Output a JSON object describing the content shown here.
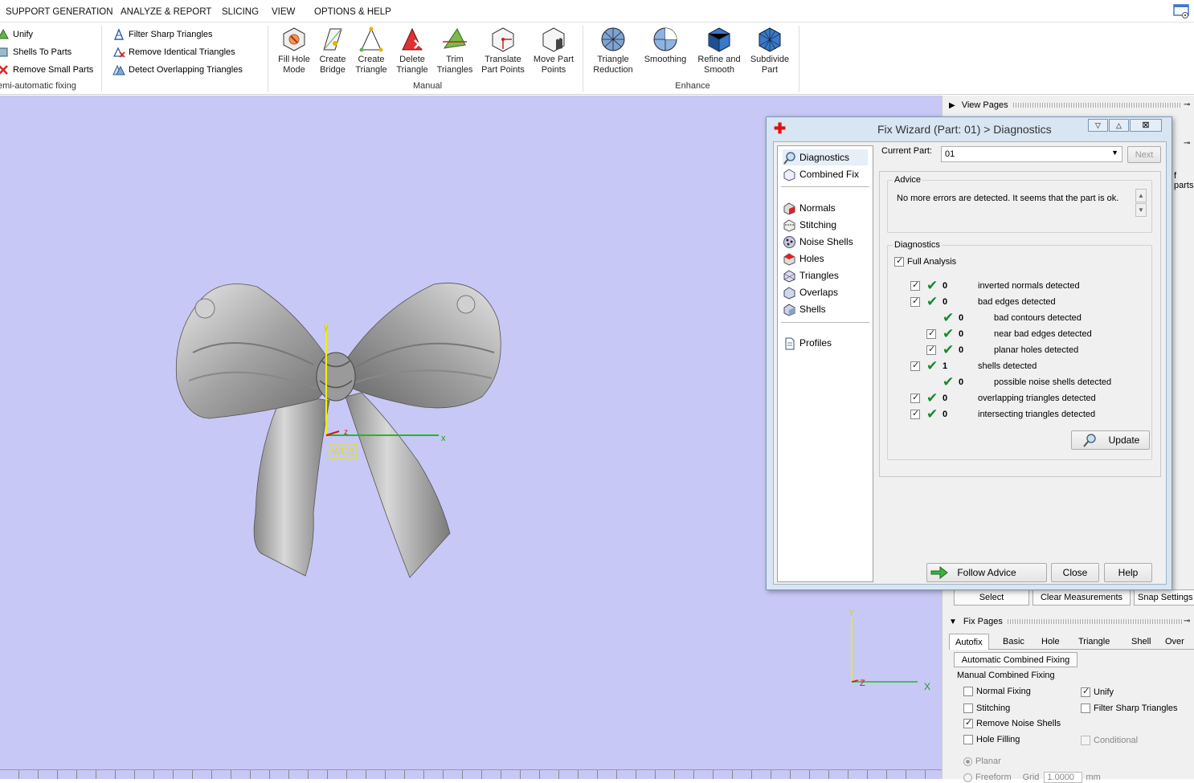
{
  "menubar": {
    "items": [
      "SUPPORT GENERATION",
      "ANALYZE & REPORT",
      "SLICING",
      "VIEW",
      "OPTIONS & HELP"
    ]
  },
  "ribbon": {
    "semi_auto_tools": [
      "Unify",
      "Shells To Parts",
      "Remove Small Parts"
    ],
    "semi_auto_title": "emi-automatic fixing",
    "filter_tools": [
      "Filter Sharp Triangles",
      "Remove Identical Triangles",
      "Detect Overlapping Triangles"
    ],
    "manual_tools": [
      {
        "line1": "Fill Hole",
        "line2": "Mode"
      },
      {
        "line1": "Create",
        "line2": "Bridge"
      },
      {
        "line1": "Create",
        "line2": "Triangle"
      },
      {
        "line1": "Delete",
        "line2": "Triangle"
      },
      {
        "line1": "Trim",
        "line2": "Triangles"
      },
      {
        "line1": "Translate",
        "line2": "Part Points"
      },
      {
        "line1": "Move Part",
        "line2": "Points"
      }
    ],
    "manual_title": "Manual",
    "enhance_tools": [
      {
        "line1": "Triangle",
        "line2": "Reduction"
      },
      {
        "line1": "Smoothing",
        "line2": ""
      },
      {
        "line1": "Refine and",
        "line2": "Smooth"
      },
      {
        "line1": "Subdivide",
        "line2": "Part"
      }
    ],
    "enhance_title": "Enhance"
  },
  "viewport": {
    "wcs_label": "WCS",
    "axis_x": "x",
    "axis_y": "y",
    "axis_z": "z",
    "mini_x": "X",
    "mini_y": "Y",
    "mini_z": "Z"
  },
  "right_panel": {
    "view_pages": "View Pages",
    "parts_fragment": "f parts",
    "measure_buttons": [
      "Select",
      "Clear Measurements",
      "Snap Settings"
    ],
    "fix_pages": "Fix Pages",
    "tabs": [
      "Autofix",
      "Basic",
      "Hole",
      "Triangle",
      "Shell",
      "Over"
    ],
    "auto_combined": "Automatic Combined Fixing",
    "manual_combined": "Manual Combined Fixing",
    "options_left": [
      {
        "label": "Normal Fixing",
        "checked": false
      },
      {
        "label": "Stitching",
        "checked": false
      },
      {
        "label": "Remove Noise Shells",
        "checked": true
      },
      {
        "label": "Hole Filling",
        "checked": false
      }
    ],
    "options_right": [
      {
        "label": "Unify",
        "checked": true
      },
      {
        "label": "Filter Sharp Triangles",
        "checked": false
      },
      {
        "label": "Conditional",
        "checked": false,
        "disabled": true
      }
    ],
    "radio_planar": "Planar",
    "radio_freeform": "Freeform",
    "grid_label": "Grid",
    "grid_value": "1.0000",
    "grid_unit": "mm"
  },
  "dialog": {
    "title": "Fix Wizard (Part: 01) > Diagnostics",
    "nav_top": [
      "Diagnostics",
      "Combined Fix"
    ],
    "nav_mid": [
      "Normals",
      "Stitching",
      "Noise Shells",
      "Holes",
      "Triangles",
      "Overlaps",
      "Shells"
    ],
    "nav_bottom": [
      "Profiles"
    ],
    "current_part_label": "Current Part:",
    "current_part_value": "01",
    "next_label": "Next",
    "advice_title": "Advice",
    "advice_text": "No more errors are detected. It seems that the part is ok.",
    "diagnostics_title": "Diagnostics",
    "full_analysis": "Full Analysis",
    "rows": [
      {
        "count": "0",
        "label": "inverted normals detected",
        "indent": 0,
        "box": true
      },
      {
        "count": "0",
        "label": "bad edges detected",
        "indent": 0,
        "box": true
      },
      {
        "count": "0",
        "label": "bad contours detected",
        "indent": 1,
        "box": false
      },
      {
        "count": "0",
        "label": "near bad edges detected",
        "indent": 1,
        "box": true
      },
      {
        "count": "0",
        "label": "planar holes detected",
        "indent": 1,
        "box": true
      },
      {
        "count": "1",
        "label": "shells detected",
        "indent": 0,
        "box": true
      },
      {
        "count": "0",
        "label": "possible noise shells detected",
        "indent": 1,
        "box": false
      },
      {
        "count": "0",
        "label": "overlapping triangles detected",
        "indent": 0,
        "box": true
      },
      {
        "count": "0",
        "label": "intersecting triangles detected",
        "indent": 0,
        "box": true
      }
    ],
    "update_label": "Update",
    "follow_advice": "Follow Advice",
    "close": "Close",
    "help": "Help"
  },
  "colors": {
    "viewport_bg": "#c8c8f6",
    "accent_check": "#1a8a2a",
    "title_red": "#e01010"
  }
}
